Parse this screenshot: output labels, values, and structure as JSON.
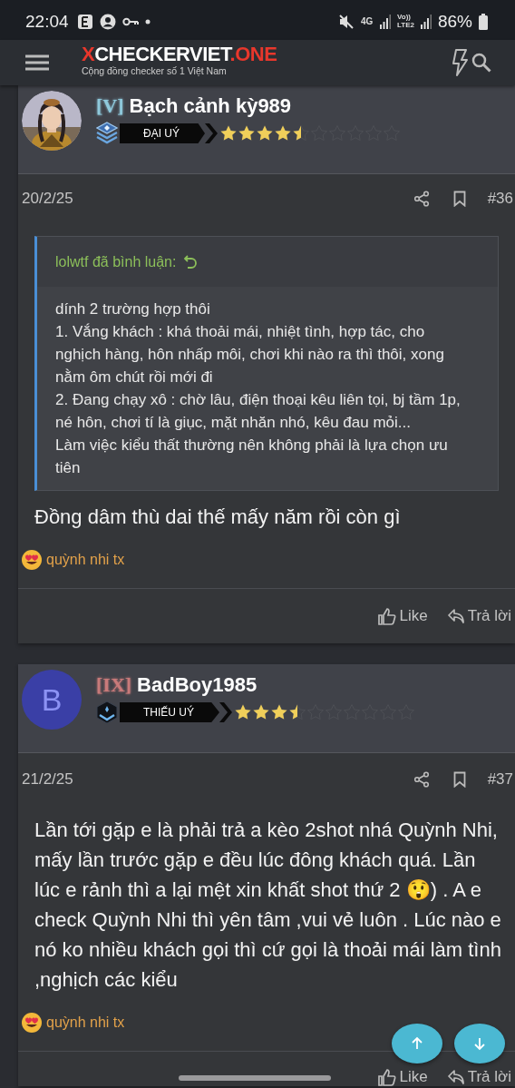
{
  "status_bar": {
    "time": "22:04",
    "network": "4G",
    "volte": "Vo))",
    "lte": "LTE2",
    "battery": "86%"
  },
  "header": {
    "logo": [
      {
        "text": "X",
        "accent": true
      },
      {
        "text": "CHECKERVIET",
        "accent": false
      },
      {
        "text": ".ONE",
        "accent": true
      }
    ],
    "tagline": "Cộng đồng checker số 1 Việt Nam"
  },
  "posts": [
    {
      "user": {
        "tag": "[V]",
        "color": "#8fc9dc",
        "name": "Bạch cảnh kỳ989",
        "emblem": {
          "kind": "stack"
        },
        "rank": "ĐẠI UÝ",
        "stars": 4.5
      },
      "date": "20/2/25",
      "number": "#36",
      "quote": {
        "author": "lolwtf đã bình luận:",
        "lines": [
          "dính 2 trường hợp thôi",
          "1. Vắng khách : khá thoải mái, nhiệt tình, hợp tác, cho nghịch hàng, hôn nhấp môi, chơi khi nào ra thì thôi, xong nằm ôm chút rồi mới đi",
          "2. Đang chạy xô : chờ lâu, điện thoại kêu liên tọi, bj tầm 1p, né hôn, chơi tí là giục, mặt nhăn nhó, kêu đau mỏi...",
          "Làm việc kiểu thất thường nên không phải là lựa chọn ưu tiên"
        ]
      },
      "text": "Đồng dâm thù dai thế mấy năm rồi còn gì",
      "signature": "quỳnh nhi tx",
      "actions": [
        "Like",
        "Trả lời"
      ]
    },
    {
      "user": {
        "tag": "[IX]",
        "color": "#c87a7a",
        "name": "BadBoy1985",
        "avatar": {
          "kind": "letter",
          "letter": "B"
        },
        "emblem": {
          "kind": "hex"
        },
        "rank": "THIẾU UÝ",
        "stars": 3.5
      },
      "date": "21/2/25",
      "number": "#37",
      "text": "Lần tới gặp e là phải trả a kèo 2shot nhá Quỳnh Nhi, mấy lần trước gặp e đều lúc đông khách quá. Lần lúc e rảnh thì a lại mệt xin khất shot thứ 2 😲) . A e check Quỳnh Nhi thì yên tâm ,vui vẻ luôn . Lúc nào e nó ko nhiều khách gọi thì cứ gọi là thoải mái làm tình ,nghịch các kiểu",
      "signature": "quỳnh nhi tx",
      "actions": [
        "Like",
        "Trả lời"
      ]
    }
  ]
}
